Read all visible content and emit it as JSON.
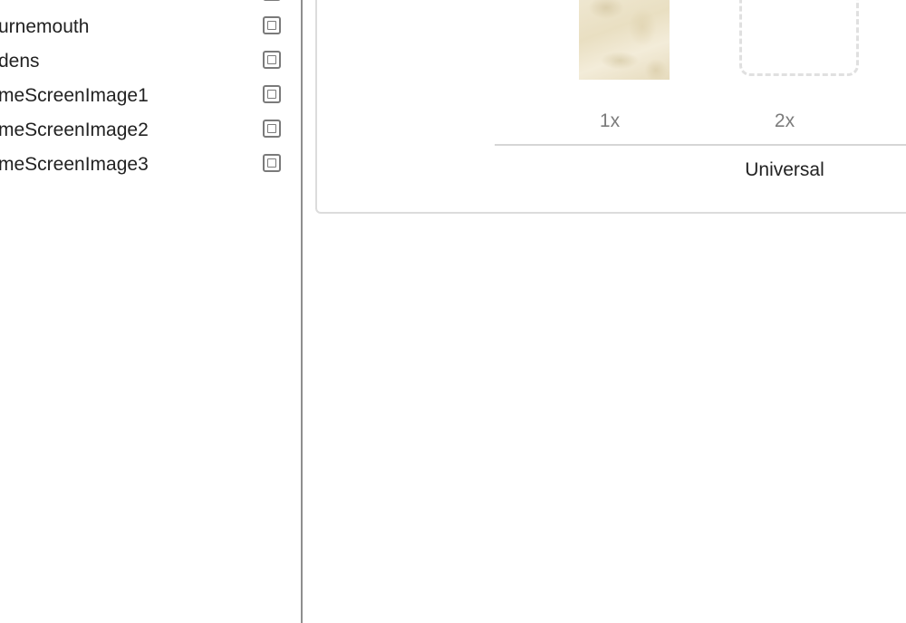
{
  "asset_list": {
    "items": [
      {
        "label": "urnemouth"
      },
      {
        "label": "dens"
      },
      {
        "label": "meScreenImage1"
      },
      {
        "label": "meScreenImage2"
      },
      {
        "label": "meScreenImage3"
      }
    ]
  },
  "image_set": {
    "slots": [
      {
        "scale": "1x",
        "filled": true
      },
      {
        "scale": "2x",
        "filled": false
      }
    ],
    "device_group_label": "Universal"
  },
  "colors": {
    "divider": "#8e8e8e",
    "icon_stroke": "#7a7a7a",
    "scale_label": "#7b7b7b",
    "panel_border": "#dcdcdc",
    "empty_slot_dash": "#e0e0e0"
  },
  "icons": {
    "image_set": "image-set-icon"
  }
}
